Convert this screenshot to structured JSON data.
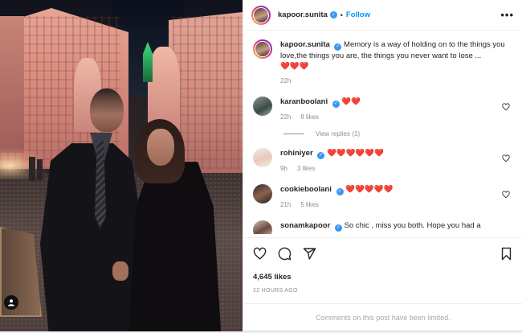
{
  "post": {
    "author": "kapoor.sunita",
    "follow_label": "Follow",
    "more_label": "•••",
    "caption": "Memory is a way of holding on to the things you love,the things you are, the things you never want to lose ... ",
    "caption_emoji": "❤️❤️❤️",
    "caption_time": "22h",
    "likes": "4,645 likes",
    "posted": "22 HOURS AGO",
    "limited_notice": "Comments on this post have been limited."
  },
  "comments": [
    {
      "user": "karanboolani",
      "verified": true,
      "text": "❤️❤️",
      "time": "22h",
      "likes": "8 likes",
      "replies": "View replies (1)"
    },
    {
      "user": "rohiniyer",
      "verified": true,
      "text": "❤️❤️❤️❤️❤️❤️",
      "time": "9h",
      "likes": "3 likes"
    },
    {
      "user": "cookieboolani",
      "verified": true,
      "text": "❤️❤️❤️❤️❤️",
      "time": "21h",
      "likes": "5 likes"
    },
    {
      "user": "sonamkapoor",
      "verified": true,
      "text": "So chic , miss you both. Hope you had a"
    }
  ],
  "icons": {
    "heart": "heart-icon",
    "comment": "comment-icon",
    "share": "share-icon",
    "save": "bookmark-icon",
    "tag": "user-tag-icon"
  },
  "colors": {
    "link": "#0095f6",
    "verified": "#3897f0",
    "heart": "#ed4956",
    "muted": "#8e8e8e"
  }
}
